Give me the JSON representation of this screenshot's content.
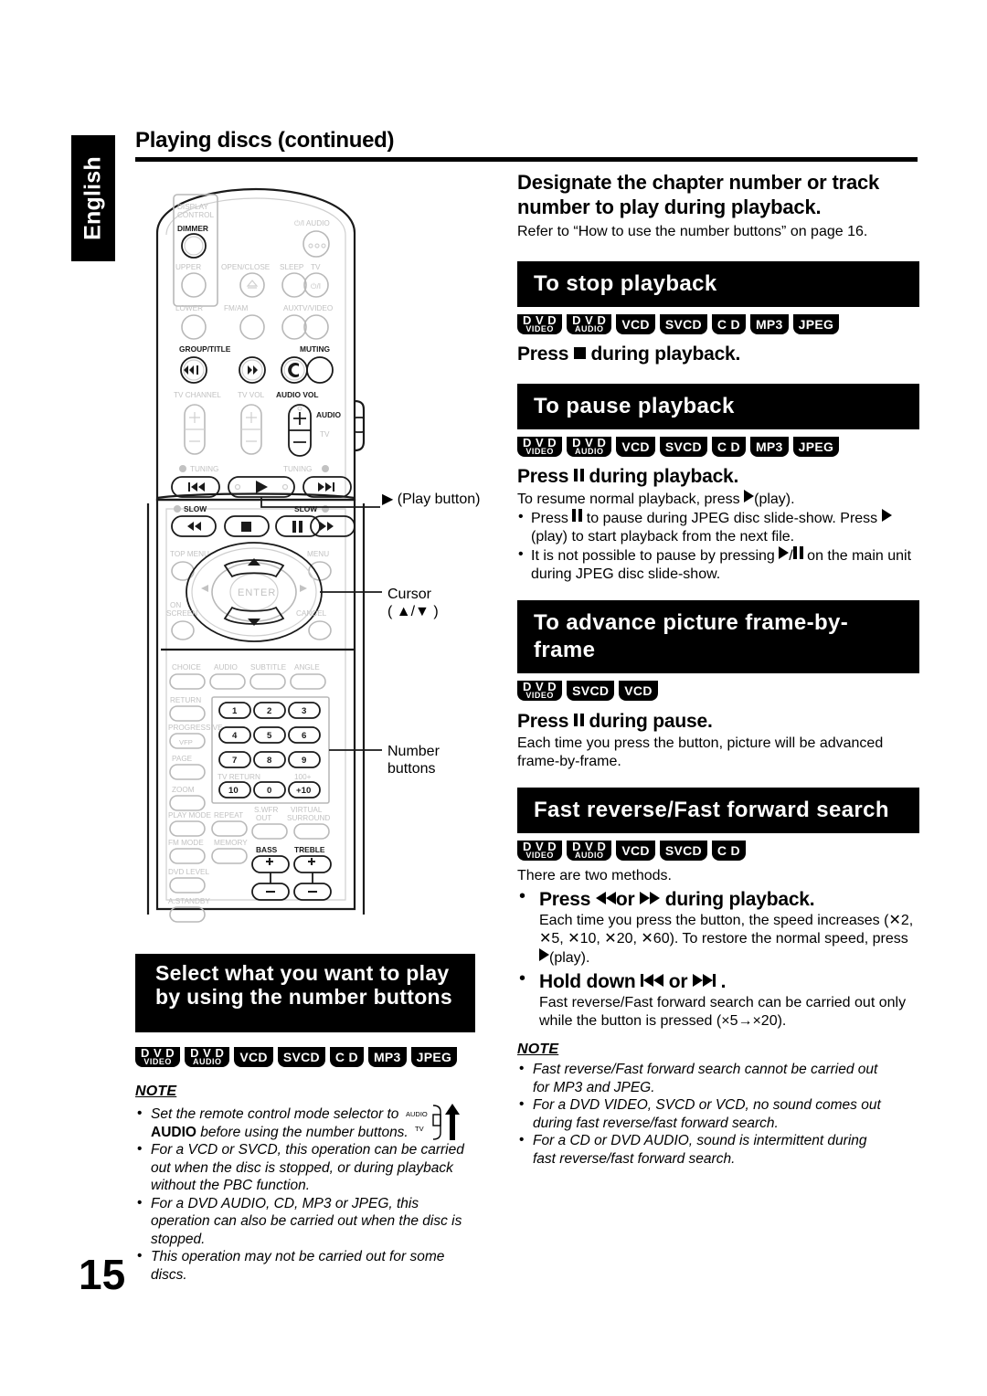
{
  "language_tab": "English",
  "page_title": "Playing discs (continued)",
  "page_number": "15",
  "callouts": {
    "play_button": "▶ (Play button)",
    "cursor_l1": "Cursor",
    "cursor_l2": "( ▲/▼ )",
    "number_l1": "Number",
    "number_l2": "buttons"
  },
  "badge_labels": {
    "dvd_video_l1": "D V D",
    "dvd_video_l2": "VIDEO",
    "dvd_audio_l1": "D V D",
    "dvd_audio_l2": "AUDIO",
    "vcd": "VCD",
    "svcd": "SVCD",
    "cd": "C D",
    "mp3": "MP3",
    "jpeg": "JPEG"
  },
  "left_column": {
    "banner": "Select what you want to play by using the number buttons",
    "note_heading": "NOTE",
    "notes": [
      "Set the remote control mode selector to AUDIO before using the number buttons.",
      "For a VCD or SVCD, this operation can be carried out when the disc is stopped, or during playback without the PBC function.",
      "For a DVD AUDIO, CD, MP3 or JPEG, this operation can also be carried out when the disc is stopped.",
      "This operation may not be carried out for some discs."
    ],
    "note1_part1": "Set the remote control mode selector to",
    "note1_bold": "AUDIO",
    "note1_part2": " before using the number buttons.",
    "selector_audio": "AUDIO",
    "selector_tv": "TV"
  },
  "right_column": {
    "intro_heading": "Designate the chapter number or track number to play during playback.",
    "intro_body": "Refer to “How to use the number buttons” on page 16.",
    "sections": [
      {
        "banner": "To stop playback",
        "press": "Press ■ during playback.",
        "press_pre": "Press ",
        "press_post": " during playback.",
        "icon": "stop",
        "body": "",
        "bullets": []
      },
      {
        "banner": "To pause playback",
        "press_pre": "Press ",
        "press_post": " during playback.",
        "icon": "pause",
        "body": "To resume normal playback, press ▶(play).",
        "bullets": [
          "Press ‖ to pause during JPEG disc slide-show. Press ▶(play) to start playback from the next file.",
          "It is not possible to pause by pressing ▶/‖ on the main unit during JPEG disc slide-show."
        ]
      },
      {
        "banner": "To advance picture frame-by-frame",
        "press_pre": "Press ",
        "press_post": " during pause.",
        "icon": "pause",
        "body": "Each time you press the button, picture will be advanced frame-by-frame.",
        "bullets": []
      },
      {
        "banner": "Fast reverse/Fast forward search",
        "body": "There are two methods.",
        "bullets": []
      }
    ],
    "fast_method1_head_pre": "Press ",
    "fast_method1_head_mid": "or",
    "fast_method1_head_post": " during playback.",
    "fast_method1_body": "Each time you press the button, the speed increases (×2, ×5, ×10, ×20, ×60). To restore the normal speed, press ▶(play).",
    "fast_method2_head_pre": "Hold down ",
    "fast_method2_head_mid": " or ",
    "fast_method2_head_post": " .",
    "fast_method2_body": "Fast reverse/Fast forward search can be carried out only while the button is pressed (×5→×20).",
    "note_heading": "NOTE",
    "notes": [
      "Fast reverse/Fast forward search cannot be carried out for MP3 and JPEG.",
      "For a DVD VIDEO, SVCD or VCD, no sound comes out during fast reverse/fast forward search.",
      "For a CD or DVD AUDIO, sound is intermittent during fast reverse/fast forward search."
    ]
  },
  "remote": {
    "labels": {
      "display_control_l1": "DISPLAY",
      "display_control_l2": "CONTROL",
      "dimmer": "DIMMER",
      "power_audio": "⏻/I AUDIO",
      "upper": "UPPER",
      "open_close": "OPEN/CLOSE",
      "sleep": "SLEEP",
      "tv": "TV",
      "lower": "LOWER",
      "fm_am": "FM/AM",
      "aux": "AUX",
      "tv_video": "TV/VIDEO",
      "group_title": "GROUP/TITLE",
      "muting": "MUTING",
      "tv_channel": "TV CHANNEL",
      "tv_vol": "TV VOL",
      "audio_vol": "AUDIO VOL",
      "audio": "AUDIO",
      "tv_side": "TV",
      "tuning_minus": "TUNING",
      "tuning_plus": "TUNING",
      "slow_minus": "SLOW",
      "slow_plus": "SLOW",
      "top_menu": "TOP MENU",
      "menu": "MENU",
      "on_screen_l1": "ON",
      "on_screen_l2": "SCREEN",
      "cancel": "CANCEL",
      "enter": "ENTER",
      "choice": "CHOICE",
      "audio_btn": "AUDIO",
      "subtitle": "SUBTITLE",
      "angle": "ANGLE",
      "return": "RETURN",
      "progressive": "PROGRESSIVE",
      "vfp": "VFP",
      "page": "PAGE",
      "zoom": "ZOOM",
      "tv_return": "TV RETURN",
      "hundred_plus": "100+",
      "play_mode": "PLAY MODE",
      "repeat": "REPEAT",
      "fm_mode": "FM MODE",
      "memory": "MEMORY",
      "swfr_l1": "S.WFR",
      "swfr_l2": "OUT",
      "virtual_l1": "VIRTUAL",
      "virtual_l2": "SURROUND",
      "dvd_level": "DVD LEVEL",
      "a_standby": "A.STANDBY",
      "bass": "BASS",
      "treble": "TREBLE"
    },
    "number_keys": [
      "1",
      "2",
      "3",
      "4",
      "5",
      "6",
      "7",
      "8",
      "9",
      "10",
      "0",
      "+10"
    ]
  }
}
